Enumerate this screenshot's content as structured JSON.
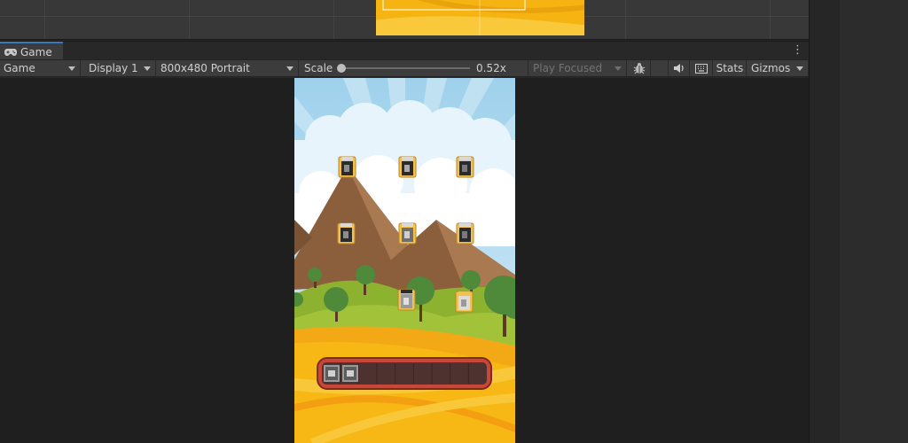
{
  "game_tab": {
    "label": "Game",
    "icon": "gamepad-icon"
  },
  "toolbar": {
    "display_mode": "Game",
    "display": "Display 1",
    "resolution": "800x480 Portrait",
    "scale_label": "Scale",
    "scale_value": "0.52x",
    "play_mode": "Play Focused",
    "stats_label": "Stats",
    "gizmos_label": "Gizmos"
  },
  "colors": {
    "sky_top": "#a6d5ee",
    "mountain": "#8b5e3c",
    "grass": "#8db22f",
    "field": "#f7b714",
    "tile_tray": "#c8473a",
    "tab_accent": "#3a79bb"
  },
  "game": {
    "collection_tray_slots": 9,
    "collected_tiles": 2
  }
}
